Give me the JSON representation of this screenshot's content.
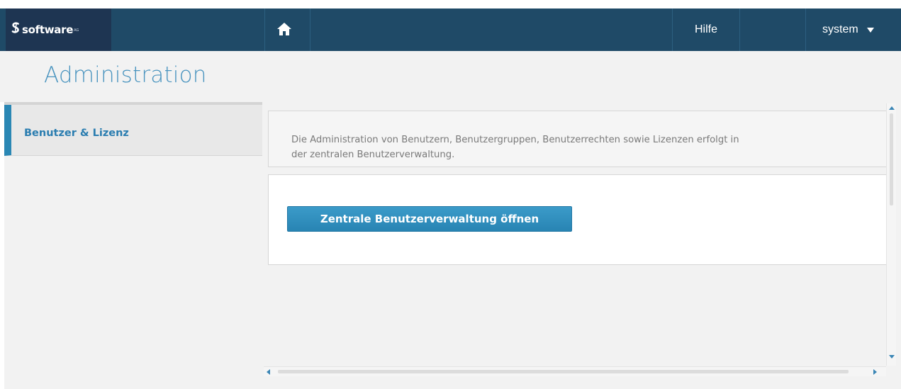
{
  "app": {
    "logo_mark": "♹",
    "logo_text": "software",
    "logo_suffix": "AG"
  },
  "topbar": {
    "home_icon": "home-icon",
    "help_label": "Hilfe",
    "user_label": "system",
    "user_caret_icon": "caret-down-icon",
    "colors": {
      "bar": "#1f4a67",
      "logo_bg": "#1e3552"
    }
  },
  "header": {
    "title": "Administration"
  },
  "sidebar": {
    "items": [
      {
        "label": "Benutzer & Lizenz",
        "active": true
      }
    ],
    "accent": "#2a87b4"
  },
  "main": {
    "info_text_line1": "Die Administration von Benutzern, Benutzergruppen, Benutzerrechten sowie Lizenzen erfolgt in",
    "info_text_line2": "der zentralen Benutzerverwaltung.",
    "open_button_label": "Zentrale Benutzerverwaltung öffnen",
    "button_color": "#2a8abc"
  }
}
